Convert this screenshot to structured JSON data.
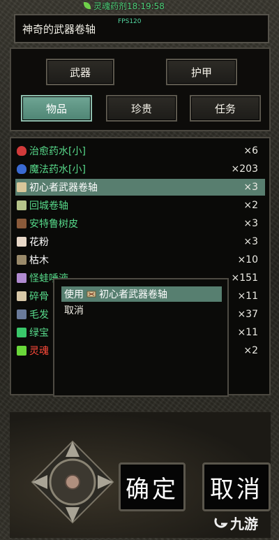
{
  "status": {
    "clock_text": "灵魂药剂18:19:58"
  },
  "window": {
    "title": "神奇的武器卷轴",
    "fps": "FPS120"
  },
  "tabs": {
    "weapon": "武器",
    "armor": "护甲",
    "items": "物品",
    "precious": "珍贵",
    "quest": "任务",
    "active": "items"
  },
  "items": [
    {
      "name": "治愈药水[小]",
      "qty": "×6",
      "color": "#57d98a",
      "icon": "red-potion-icon"
    },
    {
      "name": "魔法药水[小]",
      "qty": "×203",
      "color": "#57d98a",
      "icon": "blue-potion-icon"
    },
    {
      "name": "初心者武器卷轴",
      "qty": "×3",
      "color": "#ffffff",
      "icon": "scroll-icon",
      "selected": true
    },
    {
      "name": "回城卷轴",
      "qty": "×2",
      "color": "#57d98a",
      "icon": "town-scroll-icon"
    },
    {
      "name": "安特鲁树皮",
      "qty": "×3",
      "color": "#57d98a",
      "icon": "bark-icon"
    },
    {
      "name": "花粉",
      "qty": "×3",
      "color": "#ffffff",
      "icon": "pollen-icon"
    },
    {
      "name": "枯木",
      "qty": "×10",
      "color": "#ffffff",
      "icon": "dead-wood-icon"
    },
    {
      "name": "怪蛙唾液",
      "qty": "×151",
      "color": "#57d98a",
      "icon": "frog-saliva-icon"
    },
    {
      "name": "碎骨",
      "qty": "×11",
      "color": "#57d98a",
      "icon": "bone-icon"
    },
    {
      "name": "毛发",
      "qty": "×37",
      "color": "#57d98a",
      "icon": "hair-icon"
    },
    {
      "name": "绿宝",
      "qty": "×11",
      "color": "#57d98a",
      "icon": "green-gem-icon"
    },
    {
      "name": "灵魂",
      "qty": "×2",
      "color": "#ff4a3a",
      "icon": "soul-icon"
    }
  ],
  "context_menu": {
    "use_label": "使用",
    "use_item": "初心者武器卷轴",
    "cancel_label": "取消"
  },
  "actions": {
    "confirm": "确定",
    "cancel": "取消"
  },
  "watermark": "九游"
}
